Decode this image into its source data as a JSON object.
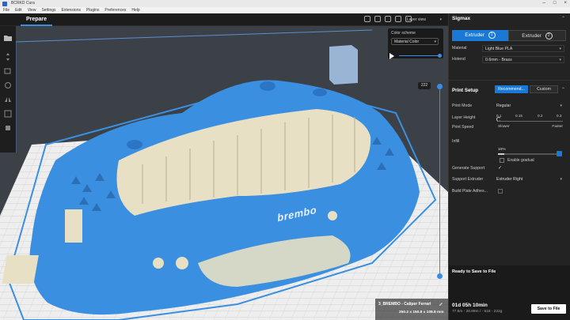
{
  "window": {
    "title": "BCRKD Cura"
  },
  "menu": [
    "File",
    "Edit",
    "View",
    "Settings",
    "Extensions",
    "Plugins",
    "Preferences",
    "Help"
  ],
  "header": {
    "stage_tab": "Prepare",
    "view_select": "Layer view",
    "view_icons": [
      "3d-view-icon",
      "front-view-icon",
      "top-view-icon",
      "left-view-icon",
      "right-view-icon"
    ]
  },
  "color_panel": {
    "label": "Color scheme",
    "value": "Material Color"
  },
  "layer_slider": {
    "current_layer": "222"
  },
  "printer": {
    "name": "Sigmax",
    "extruders": [
      {
        "label": "Extruder",
        "number": "1"
      },
      {
        "label": "Extruder",
        "number": "2"
      }
    ],
    "material_label": "Material",
    "material_value": "Light Blue PLA",
    "hotend_label": "Hotend",
    "hotend_value": "0.6mm - Brass"
  },
  "print_setup": {
    "title": "Print Setup",
    "recommended": "Recommend...",
    "custom": "Custom",
    "print_mode_label": "Print Mode",
    "print_mode_value": "Regular",
    "layer_height_label": "Layer Height",
    "layer_height_ticks": [
      "0.1",
      "0.15",
      "0.2",
      "0.3"
    ],
    "print_speed_label": "Print Speed",
    "speed_slow": "Slower",
    "speed_fast": "Faster",
    "infill_label": "Infill",
    "infill_value": "10%",
    "infill_fraction": 0.1,
    "enable_gradual": "Enable gradual",
    "generate_support_label": "Generate Support",
    "support_extruder_label": "Support Extruder",
    "support_extruder_value": "Extruder Right",
    "adhesion_label": "Build Plate Adhes..."
  },
  "output": {
    "ready": "Ready to Save to File",
    "time": "01d 05h 10min",
    "usage": "77.5m - 26.89m / - 518 - 222g",
    "save_button": "Save to File"
  },
  "model": {
    "name": "3_BREMBO - Caliper Ferrari",
    "size": "250.2 x 150.8 x 108.8 mm"
  },
  "viewport": {
    "brand_text": "brembo"
  },
  "colors": {
    "accent": "#1b79d6",
    "model_blue": "#3b8fe0",
    "infill": "#e8e0c4"
  }
}
